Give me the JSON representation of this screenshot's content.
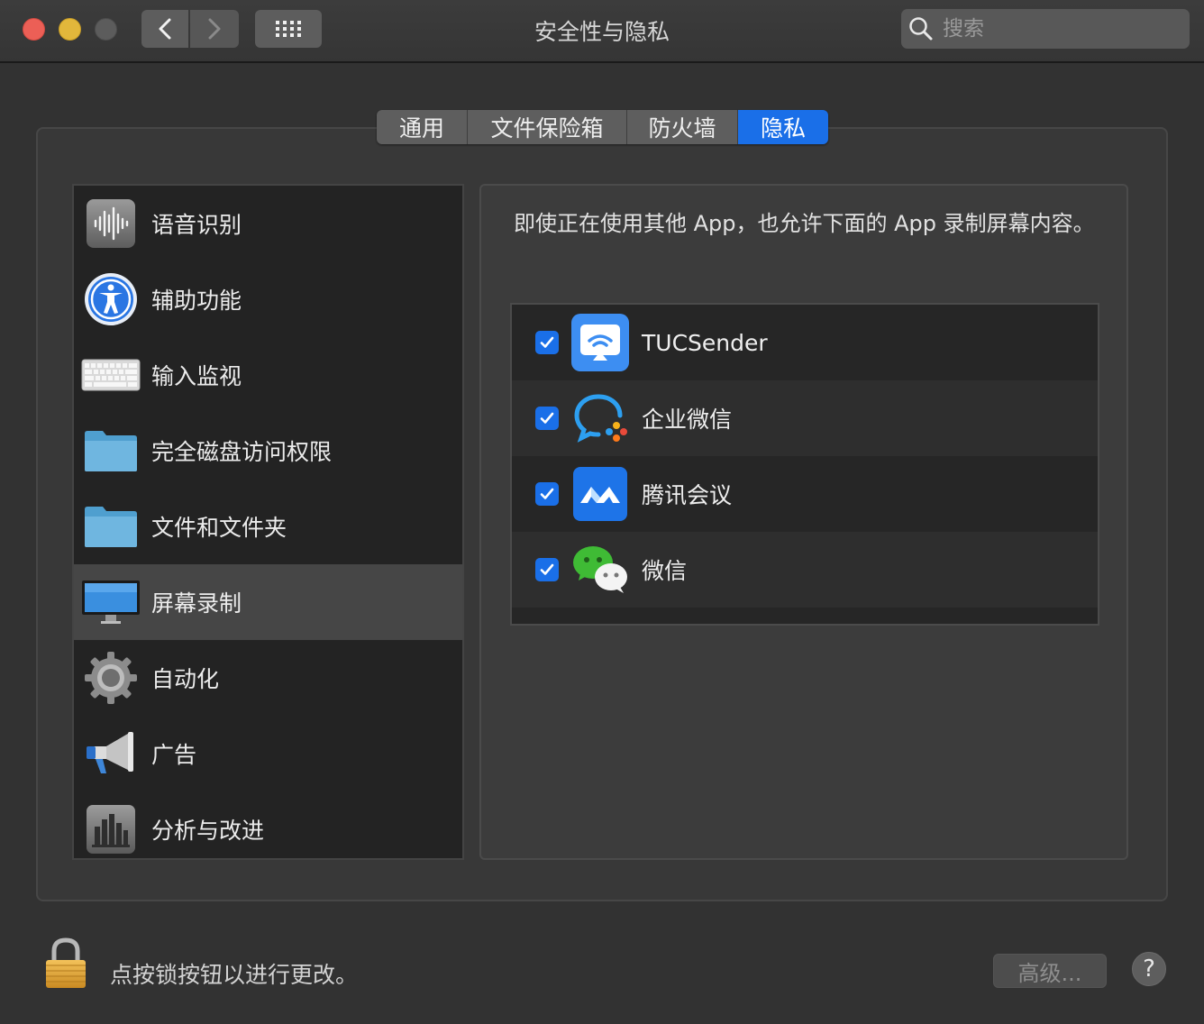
{
  "window": {
    "title": "安全性与隐私",
    "search_placeholder": "搜索"
  },
  "tabs": [
    {
      "label": "通用",
      "active": false
    },
    {
      "label": "文件保险箱",
      "active": false
    },
    {
      "label": "防火墙",
      "active": false
    },
    {
      "label": "隐私",
      "active": true
    }
  ],
  "sidebar": {
    "items": [
      {
        "label": "语音识别",
        "icon": "speech-recognition-icon"
      },
      {
        "label": "辅助功能",
        "icon": "accessibility-icon"
      },
      {
        "label": "输入监视",
        "icon": "keyboard-icon"
      },
      {
        "label": "完全磁盘访问权限",
        "icon": "folder-icon"
      },
      {
        "label": "文件和文件夹",
        "icon": "folder-icon"
      },
      {
        "label": "屏幕录制",
        "icon": "display-icon",
        "selected": true
      },
      {
        "label": "自动化",
        "icon": "gear-icon"
      },
      {
        "label": "广告",
        "icon": "megaphone-icon"
      },
      {
        "label": "分析与改进",
        "icon": "analytics-chart-icon"
      }
    ]
  },
  "content": {
    "description": "即使正在使用其他 App，也允许下面的 App 录制屏幕内容。",
    "apps": [
      {
        "name": "TUCSender",
        "checked": true,
        "icon": "tucsender-icon"
      },
      {
        "name": "企业微信",
        "checked": true,
        "icon": "wecom-icon"
      },
      {
        "name": "腾讯会议",
        "checked": true,
        "icon": "tencent-meeting-icon"
      },
      {
        "name": "微信",
        "checked": true,
        "icon": "wechat-icon"
      }
    ]
  },
  "footer": {
    "lock_text": "点按锁按钮以进行更改。",
    "advanced_label": "高级...",
    "help_label": "?"
  },
  "colors": {
    "accent": "#1a6fe8",
    "window_bg": "#323232",
    "close": "#ec5f56",
    "minimize": "#e2b73b"
  }
}
